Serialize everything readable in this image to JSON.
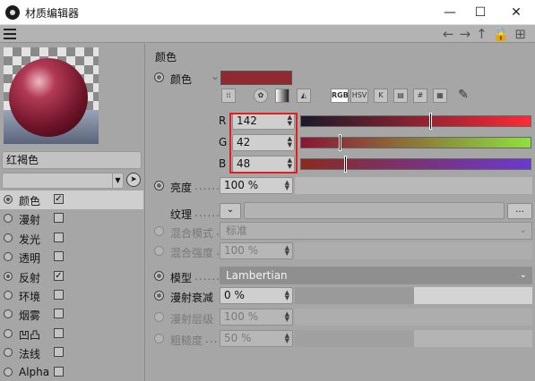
{
  "window": {
    "title": "材质编辑器",
    "minimize": "—",
    "maximize": "☐",
    "close": "✕"
  },
  "toolbar": {
    "nav_icons": "←→↑🔒⊞"
  },
  "left": {
    "material_name": "红褐色",
    "channels": [
      {
        "label": "颜色",
        "checked": true,
        "selected": true
      },
      {
        "label": "漫射",
        "checked": false
      },
      {
        "label": "发光",
        "checked": false
      },
      {
        "label": "透明",
        "checked": false
      },
      {
        "label": "反射",
        "checked": true
      },
      {
        "label": "环境",
        "checked": false
      },
      {
        "label": "烟雾",
        "checked": false
      },
      {
        "label": "凹凸",
        "checked": false
      },
      {
        "label": "法线",
        "checked": false
      },
      {
        "label": "Alpha",
        "checked": false
      }
    ]
  },
  "right": {
    "section_title": "颜色",
    "color_label": "颜色",
    "color_dots": "",
    "swatch_color": "#8e2a30",
    "tools": [
      "⁞⁞",
      "✿",
      "▪",
      "◭",
      "RGB",
      "HSV",
      "K",
      "▤",
      "#",
      "▦",
      "✎"
    ],
    "r": {
      "label": "R",
      "value": "142",
      "level": 142
    },
    "g": {
      "label": "G",
      "value": "42",
      "level": 42
    },
    "b": {
      "label": "B",
      "value": "48",
      "level": 48
    },
    "brightness": {
      "label": "亮度",
      "dots": "......",
      "value": "100 %",
      "level": 1.0
    },
    "texture": {
      "label": "纹理",
      "dots": ".........",
      "button": "...",
      "arrow": "⌄"
    },
    "blend_mode": {
      "label": "混合模式",
      "dots": "...",
      "value": "标准"
    },
    "blend_strength": {
      "label": "混合强度",
      "dots": "...",
      "value": "100 %",
      "level": 1.0
    },
    "model": {
      "label": "模型",
      "dots": ".......",
      "value": "Lambertian"
    },
    "diffuse_falloff": {
      "label": "漫射衰减",
      "value": "0 %",
      "level": 0.0
    },
    "diffuse_level": {
      "label": "漫射层级",
      "value": "100 %",
      "level": 1.0
    },
    "roughness": {
      "label": "粗糙度",
      "dots": "...",
      "value": "50 %",
      "level": 0.5
    }
  }
}
